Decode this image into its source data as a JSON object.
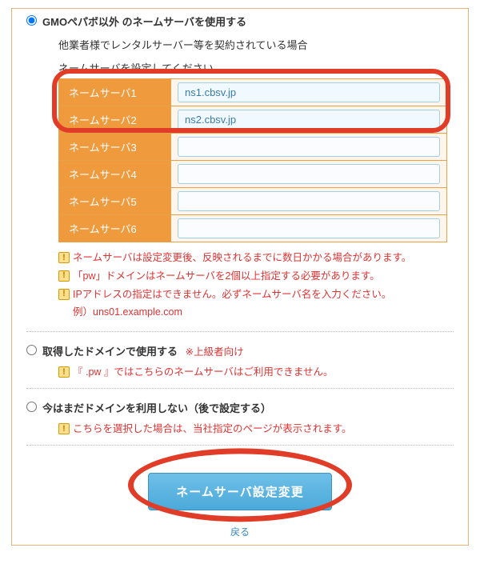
{
  "option1": {
    "title": "GMOペパボ以外 のネームサーバを使用する",
    "desc": "他業者様でレンタルサーバー等を契約されている場合",
    "instruction": "ネームサーバを設定してください",
    "ns": [
      {
        "label": "ネームサーバ1",
        "value": "ns1.cbsv.jp"
      },
      {
        "label": "ネームサーバ2",
        "value": "ns2.cbsv.jp"
      },
      {
        "label": "ネームサーバ3",
        "value": ""
      },
      {
        "label": "ネームサーバ4",
        "value": ""
      },
      {
        "label": "ネームサーバ5",
        "value": ""
      },
      {
        "label": "ネームサーバ6",
        "value": ""
      }
    ],
    "warnings": [
      "ネームサーバは設定変更後、反映されるまでに数日かかる場合があります。",
      "「pw」ドメインはネームサーバを2個以上指定する必要があります。",
      "IPアドレスの指定はできません。必ずネームサーバ名を入力ください。"
    ],
    "example": "例）uns01.example.com"
  },
  "option2": {
    "title": "取得したドメインで使用する",
    "note": "※上級者向け",
    "warning": "『 .pw 』ではこちらのネームサーバはご利用できません。"
  },
  "option3": {
    "title": "今はまだドメインを利用しない（後で設定する）",
    "warning": "こちらを選択した場合は、当社指定のページが表示されます。"
  },
  "submit_label": "ネームサーバ設定変更",
  "back_label": "戻る"
}
